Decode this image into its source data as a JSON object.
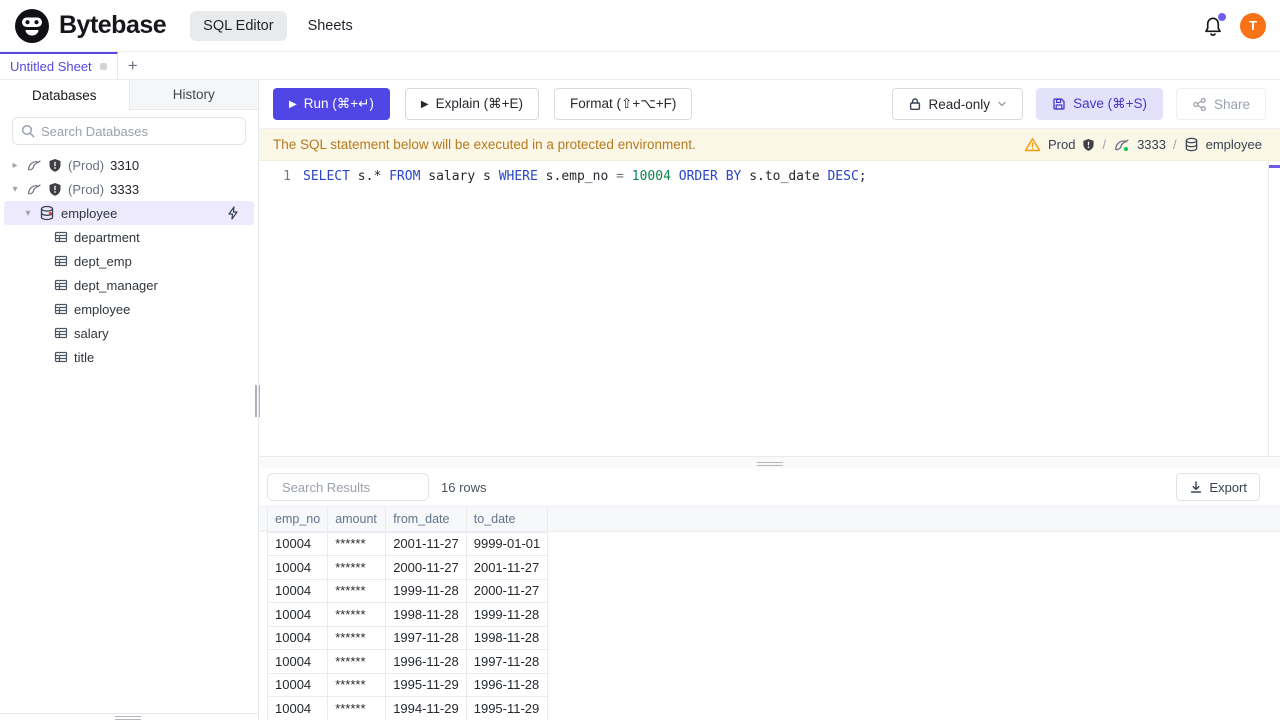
{
  "header": {
    "brand": "Bytebase",
    "nav_sql_editor": "SQL Editor",
    "nav_sheets": "Sheets",
    "avatar_initial": "T"
  },
  "sheet_tabs": {
    "active_tab": "Untitled Sheet",
    "add_label": "+"
  },
  "sidebar": {
    "tab_databases": "Databases",
    "tab_history": "History",
    "search_placeholder": "Search Databases",
    "instances": [
      {
        "env": "(Prod)",
        "name": "3310"
      },
      {
        "env": "(Prod)",
        "name": "3333"
      }
    ],
    "database": "employee",
    "tables": [
      "department",
      "dept_emp",
      "dept_manager",
      "employee",
      "salary",
      "title"
    ]
  },
  "toolbar": {
    "run_label": "Run (⌘+↵)",
    "explain_label": "Explain (⌘+E)",
    "format_label": "Format (⇧+⌥+F)",
    "readonly_label": "Read-only",
    "save_label": "Save (⌘+S)",
    "share_label": "Share"
  },
  "banner": {
    "message": "The SQL statement below will be executed in a protected environment.",
    "environment": "Prod",
    "instance": "3333",
    "database": "employee",
    "separator": "/"
  },
  "editor": {
    "line_number": "1",
    "token_colors": {
      "keyword": "#2845c8",
      "number": "#0f8650",
      "operator": "#6e7781",
      "plain": "#24292f"
    },
    "tokens": [
      {
        "text": "SELECT",
        "type": "keyword"
      },
      {
        "text": " s.* ",
        "type": "plain"
      },
      {
        "text": "FROM",
        "type": "keyword"
      },
      {
        "text": " salary s ",
        "type": "plain"
      },
      {
        "text": "WHERE",
        "type": "keyword"
      },
      {
        "text": " s.emp_no ",
        "type": "plain"
      },
      {
        "text": "= ",
        "type": "operator"
      },
      {
        "text": "10004",
        "type": "number"
      },
      {
        "text": " ",
        "type": "plain"
      },
      {
        "text": "ORDER BY",
        "type": "keyword"
      },
      {
        "text": " s.to_date ",
        "type": "plain"
      },
      {
        "text": "DESC",
        "type": "keyword"
      },
      {
        "text": ";",
        "type": "plain"
      }
    ]
  },
  "results": {
    "search_placeholder": "Search Results",
    "row_count": "16 rows",
    "export_label": "Export",
    "columns": [
      "emp_no",
      "amount",
      "from_date",
      "to_date"
    ],
    "rows": [
      [
        "10004",
        "******",
        "2001-11-27",
        "9999-01-01"
      ],
      [
        "10004",
        "******",
        "2000-11-27",
        "2001-11-27"
      ],
      [
        "10004",
        "******",
        "1999-11-28",
        "2000-11-27"
      ],
      [
        "10004",
        "******",
        "1998-11-28",
        "1999-11-28"
      ],
      [
        "10004",
        "******",
        "1997-11-28",
        "1998-11-28"
      ],
      [
        "10004",
        "******",
        "1996-11-28",
        "1997-11-28"
      ],
      [
        "10004",
        "******",
        "1995-11-29",
        "1996-11-28"
      ],
      [
        "10004",
        "******",
        "1994-11-29",
        "1995-11-29"
      ]
    ]
  },
  "colors": {
    "accent": "#4f46e5",
    "save_bg": "#e4e1fb",
    "selected_row_bg": "#eceafc",
    "banner_bg": "#fbf7e6",
    "banner_text": "#b7791f",
    "avatar_bg": "#f97316",
    "badge": "#6d5ef0",
    "warning": "#f59e0b"
  }
}
